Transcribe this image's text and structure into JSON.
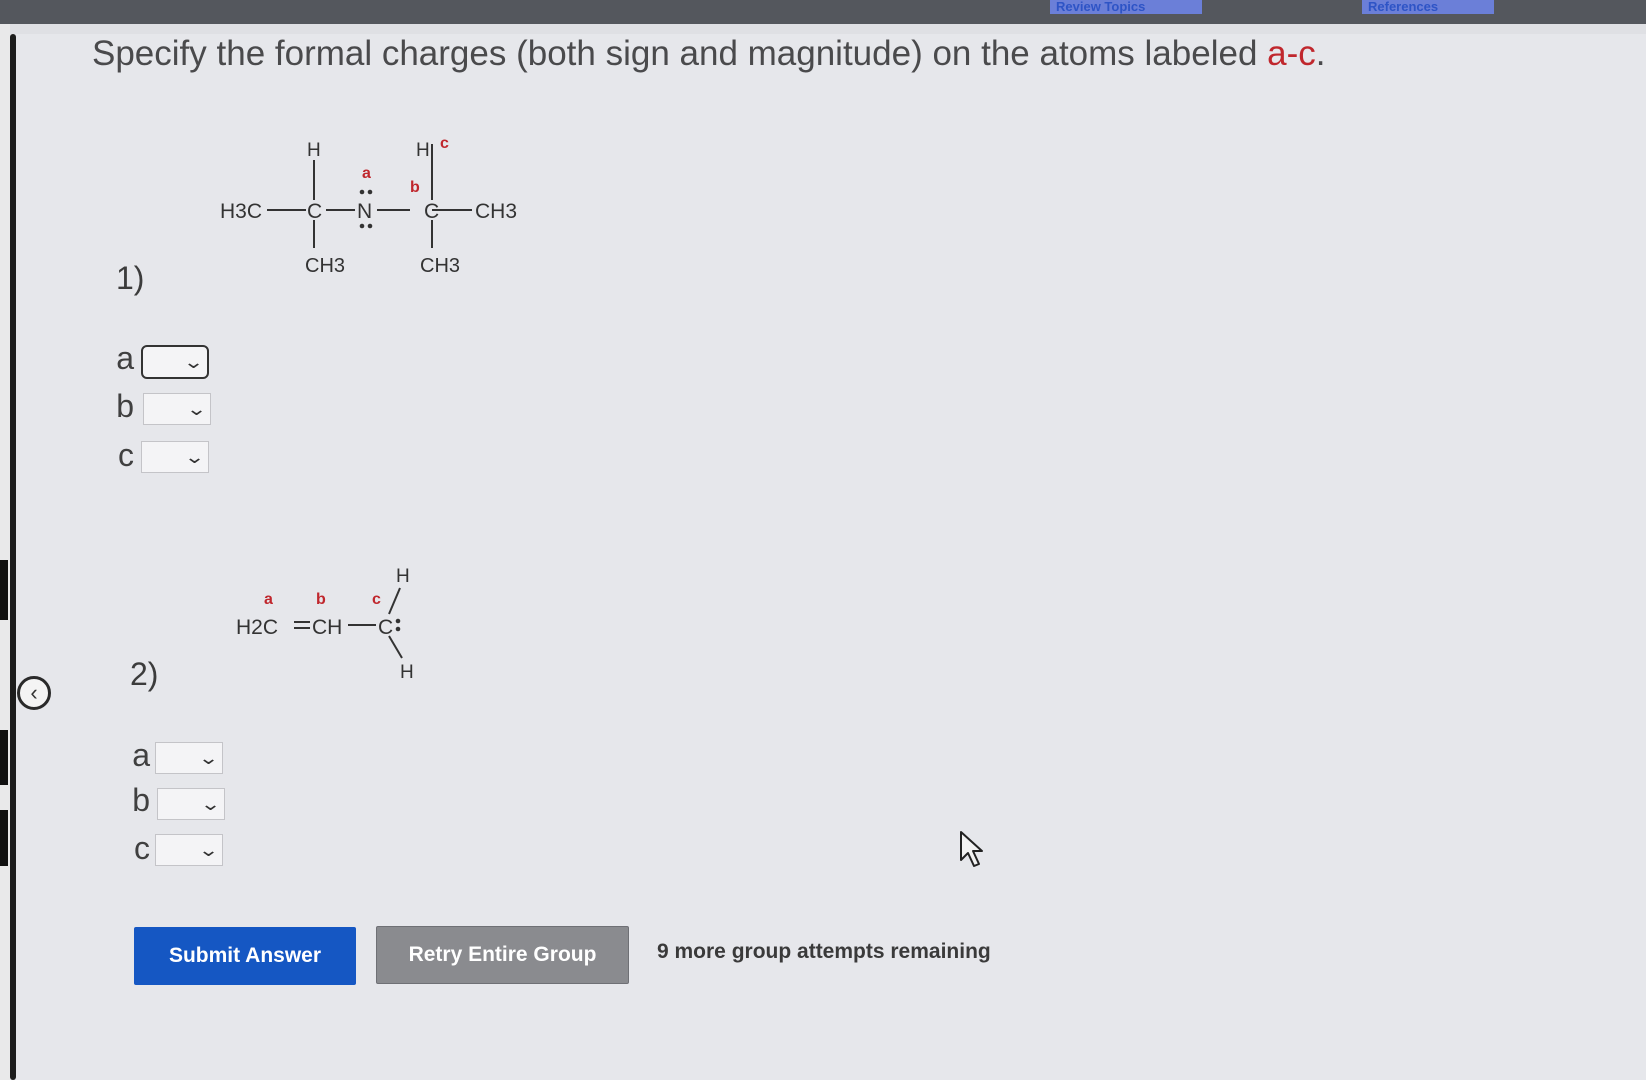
{
  "toolbar": {
    "link1": "Review Topics",
    "link2": "References"
  },
  "question": {
    "text": "Specify the formal charges (both sign and magnitude) on the atoms labeled ",
    "highlight": "a-c",
    "end": "."
  },
  "problems": [
    {
      "number": "1)",
      "structure": {
        "h_top1": "H",
        "h_top2": "H",
        "h3c": "H3C",
        "c1": "C",
        "n": "N",
        "c2": "C",
        "ch3_right": "CH3",
        "ch3_bottom1": "CH3",
        "ch3_bottom2": "CH3",
        "label_a": "a",
        "label_b": "b",
        "label_c": "c"
      },
      "fields": [
        {
          "label": "a",
          "value": ""
        },
        {
          "label": "b",
          "value": ""
        },
        {
          "label": "c",
          "value": ""
        }
      ]
    },
    {
      "number": "2)",
      "structure": {
        "h2c": "H2C",
        "eq": "=",
        "ch": "CH",
        "dash": "—",
        "c": "C",
        "h_top": "H",
        "h_bottom": "H",
        "label_a": "a",
        "label_b": "b",
        "label_c": "c"
      },
      "fields": [
        {
          "label": "a",
          "value": ""
        },
        {
          "label": "b",
          "value": ""
        },
        {
          "label": "c",
          "value": ""
        }
      ]
    }
  ],
  "actions": {
    "submit": "Submit Answer",
    "retry": "Retry Entire Group",
    "attempts": "9 more group attempts remaining"
  },
  "colors": {
    "accent": "#1557c3",
    "label_red": "#c0272d",
    "retry_gray": "#8a8b8f"
  },
  "icons": {
    "collapse": "chevron-left-icon",
    "dropdown": "chevron-down-icon",
    "pointer": "mouse-cursor-icon"
  }
}
